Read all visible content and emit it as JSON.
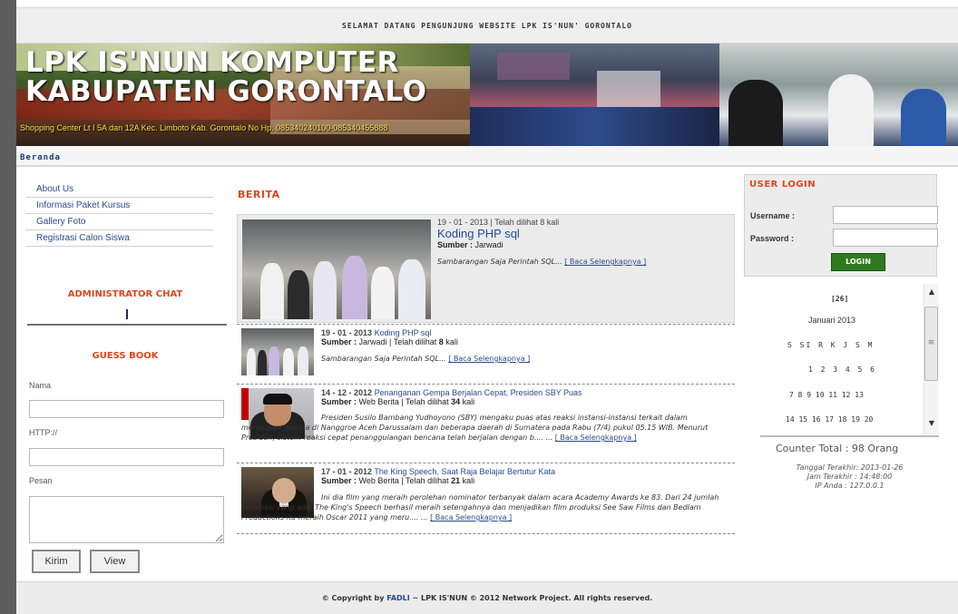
{
  "header": {
    "welcome": "SELAMAT DATANG PENGUNJUNG WEBSITE LPK IS'NUN' GORONTALO",
    "banner_title_1": "LPK IS'NUN KOMPUTER",
    "banner_title_2": "KABUPATEN GORONTALO",
    "banner_subtitle": "Shopping Center Lt I 5A dan 12A Kec. Limboto Kab. Gorontalo No Hp. 085340240100-085340455888"
  },
  "nav": {
    "home": "Beranda"
  },
  "sidebar": {
    "menu": [
      "About Us",
      "Informasi Paket Kursus",
      "Gallery Foto",
      "Registrasi Calon Siswa"
    ],
    "chat_title": "ADMINISTRATOR CHAT",
    "guestbook_title": "GUESS BOOK",
    "name_label": "Nama",
    "http_label": "HTTP://",
    "message_label": "Pesan",
    "send_button": "Kirim",
    "view_button": "View"
  },
  "news": {
    "section_title": "BERITA",
    "headline": {
      "meta": "19 - 01 - 2013 | Telah dilihat 8 kali",
      "title": "Koding PHP sql",
      "source_label": "Sumber :",
      "source": "Jarwadi",
      "excerpt": "Sambarangan Saja Perintah SQL...",
      "more": "[ Baca Selengkapnya ]"
    },
    "items": [
      {
        "date": "19 - 01 - 2013",
        "title": "Koding PHP sql",
        "source_label": "Sumber :",
        "source_meta": "Jarwadi | Telah dilihat",
        "views": "8",
        "views_suffix": "kali",
        "excerpt": "Sambarangan Saja Perintah SQL...",
        "more": "[ Baca Selengkapnya ]"
      },
      {
        "date": "14 - 12 - 2012",
        "title": "Penanganan Gempa Berjalan Cepat, Presiden SBY Puas",
        "source_label": "Sumber :",
        "source_meta": "Web Berita | Telah dilihat",
        "views": "34",
        "views_suffix": "kali",
        "excerpt": "Presiden Susilo Bambang Yudhoyono (SBY) mengaku puas atas reaksi instansi-instansi terkait dalam menangani gempa di Nanggroe Aceh Darussalam dan beberapa daerah di Sumatera pada Rabu (7/4) pukul 05.15 WIB. Menurut Presiden, sistem reaksi cepat penanggulangan bencana telah berjalan dengan b.... ...",
        "more": "[ Baca Selengkapnya ]"
      },
      {
        "date": "17 - 01 - 2012",
        "title": "The King Speech, Saat Raja Belajar Bertutur Kata",
        "source_label": "Sumber :",
        "source_meta": "Web Berita | Telah dilihat",
        "views": "21",
        "views_suffix": "kali",
        "excerpt": "Ini dia film yang meraih perolehan nominator terbanyak dalam acara Academy Awards ke 83. Dari 24 jumlah nominasi yang ada, The King's Speech berhasil meraih setengahnya dan menjadikan film produksi See Saw Films dan Bedlam Productions itu meraih Oscar 2011 yang meru.... ...",
        "more": "[ Baca Selengkapnya ]"
      }
    ]
  },
  "login": {
    "title": "USER LOGIN",
    "username_label": "Username :",
    "password_label": "Password :",
    "button": "LOGIN"
  },
  "calendar": {
    "today": "[26]",
    "month_year": "Januari 2013",
    "weekdays": "S SI R K J S M",
    "rows": [
      "1 2 3 4 5 6",
      "7 8 9 10 11 12 13",
      "14 15 16 17 18 19 20"
    ]
  },
  "counter": {
    "total": "Counter Total : 98 Orang",
    "last_date": "Tanggal Terakhir: 2013-01-26",
    "last_time": "Jam Terakhir : 14:48:00",
    "ip": "IP Anda : 127.0.0.1"
  },
  "footer": {
    "prefix": "© Copyright by",
    "author": "FADLI",
    "suffix": "~ LPK IS'NUN © 2012 Network Project. All rights reserved."
  },
  "colors": {
    "accent": "#e0461b",
    "link": "#274a8c",
    "login_button": "#2f7a1f"
  }
}
